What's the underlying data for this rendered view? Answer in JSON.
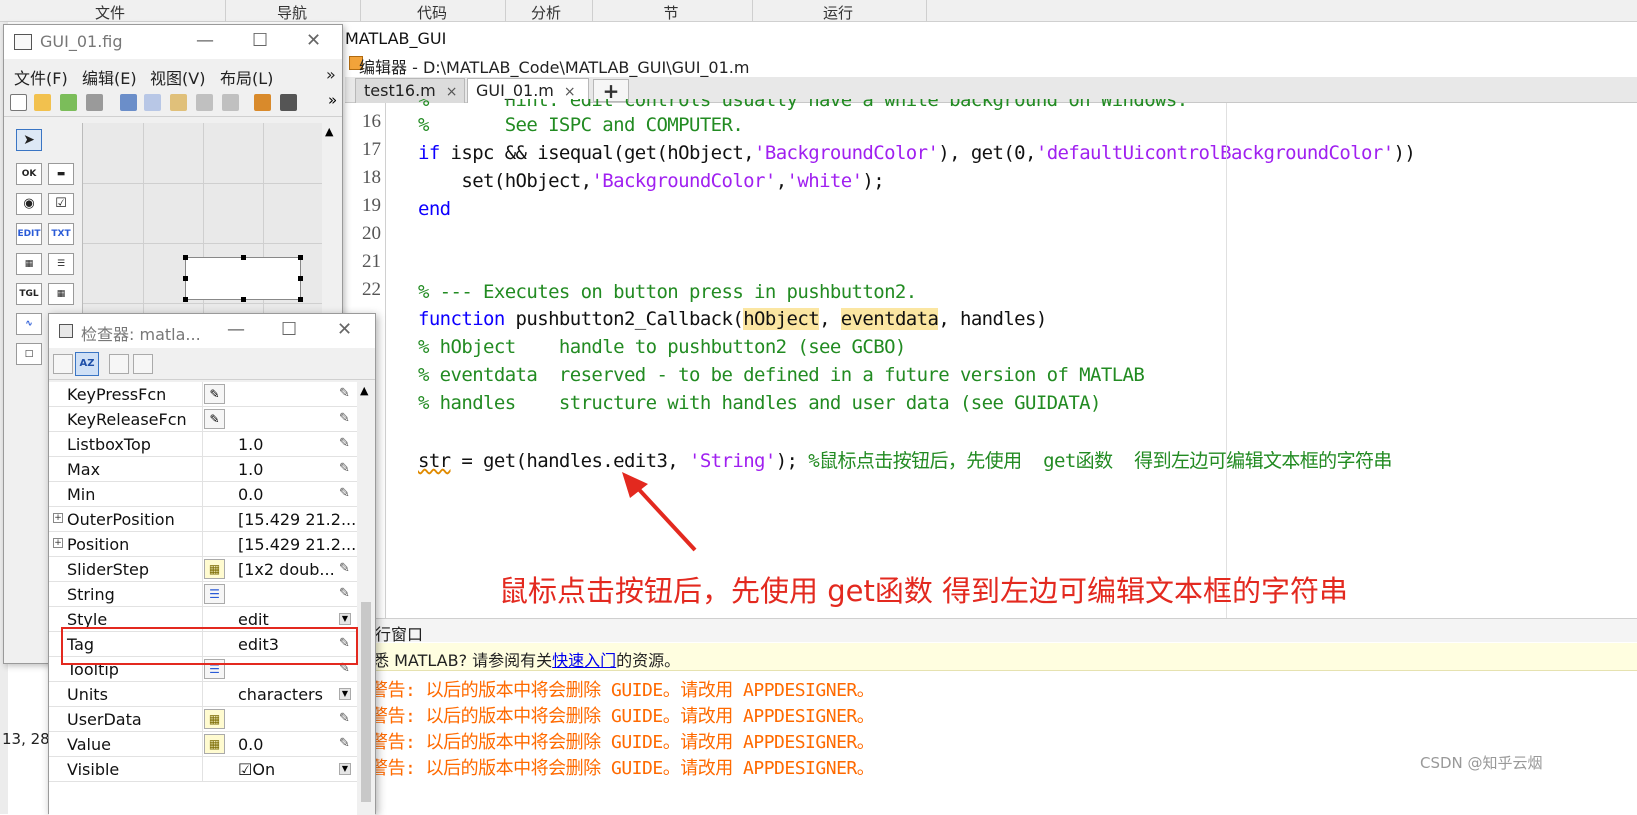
{
  "ribbon": {
    "tabs": [
      "文件",
      "导航",
      "代码",
      "分析",
      "节",
      "运行"
    ]
  },
  "editor": {
    "current_folder": "MATLAB_GUI",
    "title": "编辑器 - D:\\MATLAB_Code\\MATLAB_GUI\\GUI_01.m",
    "tabs": [
      {
        "label": "test16.m",
        "close": "×"
      },
      {
        "label": "GUI_01.m",
        "close": "×"
      }
    ],
    "add_tab": "+",
    "partial_top_line": "%       hint: edit controls usually have a white background on Windows.",
    "line_numbers": [
      "16",
      "17",
      "18",
      "19",
      "20",
      "21",
      "22"
    ],
    "code": {
      "l16": "%       See ISPC and COMPUTER.",
      "l17_kw": "if",
      "l17_rest": " ispc && isequal(get(hObject,",
      "l17_s1": "'BackgroundColor'",
      "l17_mid": "), get(0,",
      "l17_s2": "'defaultUicontrolBackgroundColor'",
      "l17_end": "))",
      "l18_pre": "    set(hObject,",
      "l18_s1": "'BackgroundColor'",
      "l18_comma": ",",
      "l18_s2": "'white'",
      "l18_end": ");",
      "l19": "end",
      "l22": "% --- Executes on button press in pushbutton2.",
      "l23_kw": "function",
      "l23_a": " pushbutton2_Callback(",
      "l23_h": "hObject",
      "l23_b": ", ",
      "l23_e": "eventdata",
      "l23_c": ", handles)",
      "l24": "% hObject    handle to pushbutton2 (see GCBO)",
      "l25": "% eventdata  reserved - to be defined in a future version of MATLAB",
      "l26": "% handles    structure with handles and user data (see GUIDATA)",
      "l28_var": "str",
      "l28_mid": " = get(handles.edit3, ",
      "l28_str": "'String'",
      "l28_end": "); ",
      "l28_cm": "%鼠标点击按钮后，先使用  get函数  得到左边可编辑文本框的字符串"
    },
    "annotation": "鼠标点击按钮后，先使用  get函数  得到左边可编辑文本框的字符串"
  },
  "command_window": {
    "header": "行窗口",
    "info_pre": "悉 MATLAB? 请参阅有关",
    "info_link": "快速入门",
    "info_post": "的资源。",
    "warnings": [
      "警告: 以后的版本中将会删除 GUIDE。请改用 APPDESIGNER。",
      "警告: 以后的版本中将会删除 GUIDE。请改用 APPDESIGNER。",
      "警告: 以后的版本中将会删除 GUIDE。请改用 APPDESIGNER。",
      "警告: 以后的版本中将会删除 GUIDE。请改用 APPDESIGNER。"
    ]
  },
  "left_strip": {
    "coords": "13, 28"
  },
  "fig_window": {
    "title": "GUI_01.fig",
    "menu": [
      "文件(F)",
      "编辑(E)",
      "视图(V)",
      "布局(L)"
    ],
    "menu_more": "»",
    "toolbar_more": "»",
    "palette": [
      "OK",
      "EDIT",
      "TXT",
      "TGL"
    ]
  },
  "inspector": {
    "title": "检查器:  matla...",
    "properties": [
      {
        "name": "KeyPressFcn",
        "value": "",
        "editor": true
      },
      {
        "name": "KeyReleaseFcn",
        "value": "",
        "editor": true
      },
      {
        "name": "ListboxTop",
        "value": "1.0"
      },
      {
        "name": "Max",
        "value": "1.0"
      },
      {
        "name": "Min",
        "value": "0.0"
      },
      {
        "name": "OuterPosition",
        "value": "[15.429 21.2...",
        "expandable": true
      },
      {
        "name": "Position",
        "value": "[15.429 21.2...",
        "expandable": true
      },
      {
        "name": "SliderStep",
        "value": "[1x2  doub...",
        "grid": true
      },
      {
        "name": "String",
        "value": "",
        "list": true
      },
      {
        "name": "Style",
        "value": "edit",
        "dropdown": true
      },
      {
        "name": "Tag",
        "value": "edit3"
      },
      {
        "name": "Tooltip",
        "value": "",
        "list": true
      },
      {
        "name": "Units",
        "value": "characters",
        "dropdown": true
      },
      {
        "name": "UserData",
        "value": "",
        "grid": true
      },
      {
        "name": "Value",
        "value": "0.0",
        "grid": true
      },
      {
        "name": "Visible",
        "value": "On",
        "checkbox": true
      }
    ]
  },
  "watermark": "CSDN @知乎云烟",
  "colors": {
    "accent_red": "#e3291f",
    "keyword": "#0e00ff",
    "comment": "#228b22",
    "string": "#a020f0",
    "warning": "#ff6a00"
  }
}
